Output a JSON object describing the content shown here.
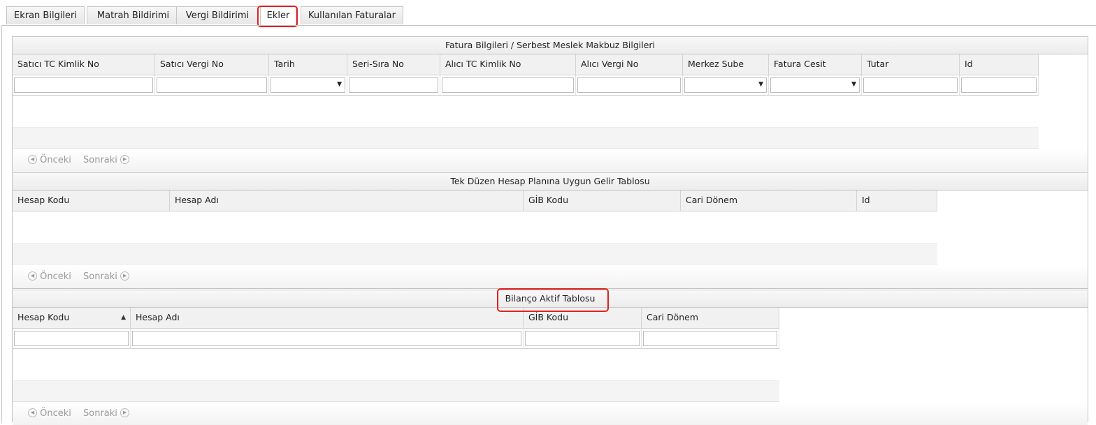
{
  "tabs": [
    {
      "label": "Ekran Bilgileri"
    },
    {
      "label": "Matrah Bildirimi"
    },
    {
      "label": "Vergi Bildirimi"
    },
    {
      "label": "Ekler",
      "active": true
    },
    {
      "label": "Kullanılan Faturalar"
    }
  ],
  "highlight_color": "#e02020",
  "panels": [
    {
      "title": "Fatura Bilgileri / Serbest Meslek Makbuz Bilgileri",
      "columns": [
        {
          "label": "Satıcı TC Kimlik No",
          "filter": "text"
        },
        {
          "label": "Satıcı Vergi No",
          "filter": "text"
        },
        {
          "label": "Tarih",
          "filter": "select"
        },
        {
          "label": "Seri-Sıra No",
          "filter": "text"
        },
        {
          "label": "Alıcı TC Kimlik No",
          "filter": "text"
        },
        {
          "label": "Alıcı Vergi No",
          "filter": "text"
        },
        {
          "label": "Merkez Sube",
          "filter": "select"
        },
        {
          "label": "Fatura Cesit",
          "filter": "select"
        },
        {
          "label": "Tutar",
          "filter": "text"
        },
        {
          "label": "Id",
          "filter": "text"
        }
      ],
      "pager": {
        "prev": "Önceki",
        "next": "Sonraki"
      }
    },
    {
      "title": "Tek Düzen Hesap Planına Uygun Gelir Tablosu",
      "columns": [
        {
          "label": "Hesap Kodu"
        },
        {
          "label": "Hesap Adı"
        },
        {
          "label": "GİB Kodu"
        },
        {
          "label": "Cari Dönem"
        },
        {
          "label": "Id"
        }
      ],
      "pager": {
        "prev": "Önceki",
        "next": "Sonraki"
      }
    },
    {
      "title": "Bilanço Aktif Tablosu",
      "highlighted": true,
      "columns": [
        {
          "label": "Hesap Kodu",
          "filter": "text",
          "sort": "ascending"
        },
        {
          "label": "Hesap Adı",
          "filter": "text"
        },
        {
          "label": "GİB Kodu",
          "filter": "text"
        },
        {
          "label": "Cari Dönem",
          "filter": "text"
        }
      ],
      "pager": {
        "prev": "Önceki",
        "next": "Sonraki"
      }
    }
  ]
}
